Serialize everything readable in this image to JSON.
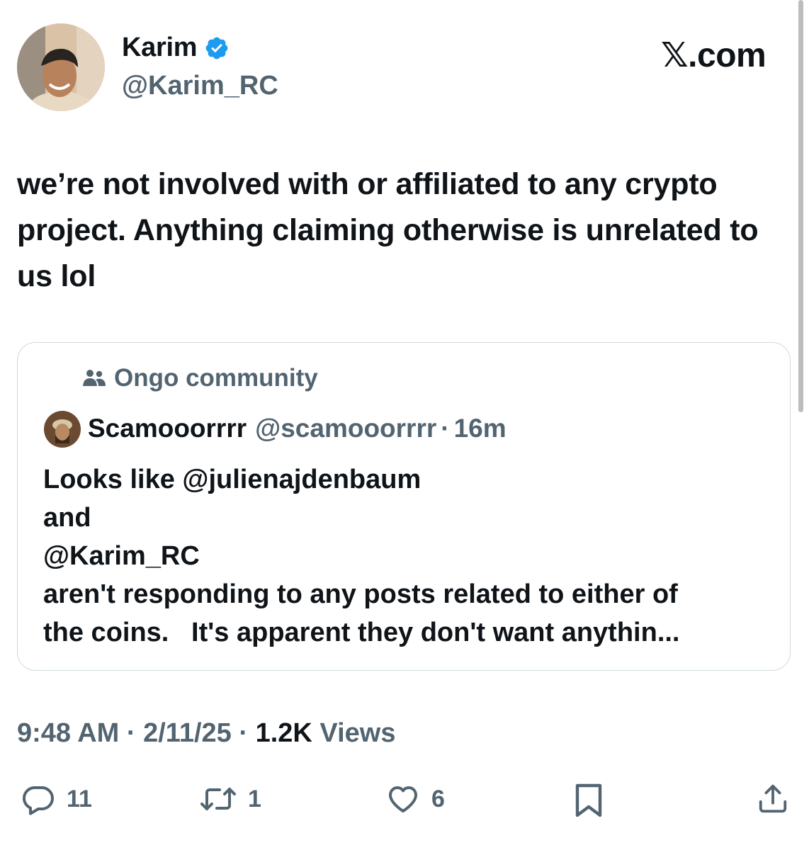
{
  "author": {
    "name": "Karim",
    "handle": "@Karim_RC",
    "verified_icon": "verified-badge-icon",
    "verified_color": "#1d9bf0"
  },
  "brand": "𝕏.com",
  "tweet": {
    "text": "we’re not involved with or affiliated to any crypto project. Anything claiming otherwise is unrelated to us lol"
  },
  "quote": {
    "community_icon": "community-icon",
    "community": "Ongo community",
    "author_name": "Scamooorrrr",
    "author_handle": "@scamooorrrr",
    "separator": "·",
    "time": "16m",
    "lines": [
      "Looks like @julienajdenbaum",
      "and",
      "@Karim_RC",
      "aren't responding to any posts related to either of",
      "the coins.   It's apparent they don't want anythin..."
    ]
  },
  "meta": {
    "time": "9:48 AM",
    "sep": "·",
    "date": "2/11/25",
    "views_count": "1.2K",
    "views_label": "Views"
  },
  "actions": {
    "replies": "11",
    "reposts": "1",
    "likes": "6"
  },
  "colors": {
    "text": "#0f1419",
    "secondary": "#536471",
    "border": "#cfd9de"
  }
}
